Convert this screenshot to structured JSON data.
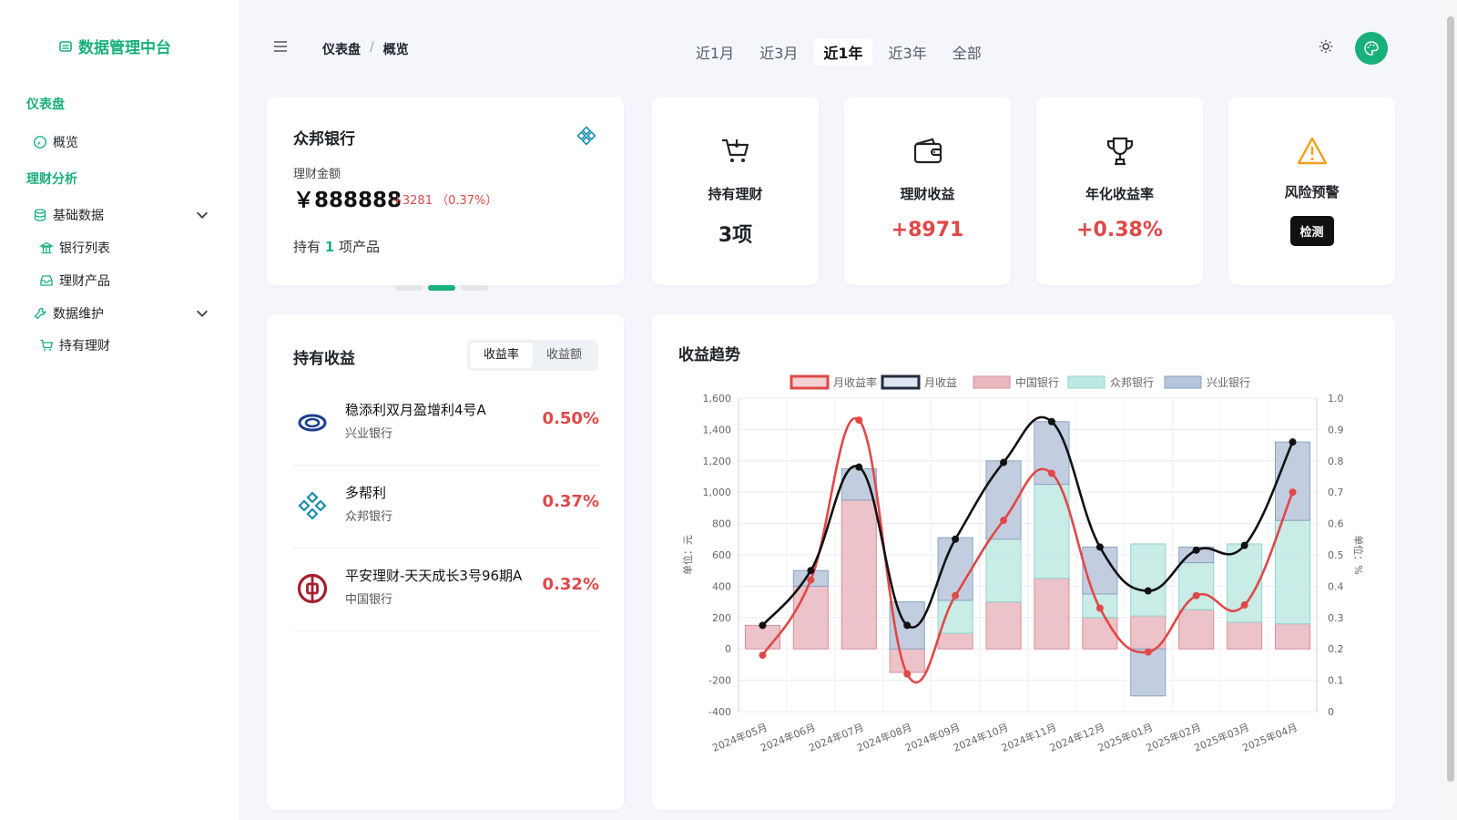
{
  "sidebar": {
    "app_title": "数据管理中台",
    "sections": [
      {
        "title": "仪表盘"
      },
      {
        "title": "理财分析"
      }
    ],
    "items": {
      "overview": "概览",
      "basic_data": "基础数据",
      "bank_list": "银行列表",
      "products": "理财产品",
      "maintenance": "数据维护",
      "holdings": "持有理财"
    }
  },
  "topbar": {
    "breadcrumb": [
      "仪表盘",
      "概览"
    ],
    "separator": "/",
    "ranges": [
      "近1月",
      "近3月",
      "近1年",
      "近3年",
      "全部"
    ],
    "active_range": "近1年"
  },
  "bank_card": {
    "name": "众邦银行",
    "amount_label": "理财金额",
    "amount": "￥888888",
    "change": "+3281 （0.37%）",
    "hold_prefix": "持有",
    "hold_count": "1",
    "hold_suffix": "项产品",
    "carousel_active_index": 1,
    "carousel_count": 3
  },
  "stats": [
    {
      "icon": "cart-icon",
      "label": "持有理财",
      "value": "3项"
    },
    {
      "icon": "wallet-icon",
      "label": "理财收益",
      "value": "+8971"
    },
    {
      "icon": "trophy-icon",
      "label": "年化收益率",
      "value": "+0.38%"
    },
    {
      "icon": "warning-icon",
      "label": "风险预警",
      "button": "检测"
    }
  ],
  "holdings": {
    "title": "持有收益",
    "tabs": [
      "收益率",
      "收益额"
    ],
    "active_tab": "收益率",
    "items": [
      {
        "name": "稳添利双月盈增利4号A",
        "bank": "兴业银行",
        "rate": "0.50%",
        "logo": "cib-logo-icon"
      },
      {
        "name": "多帮利",
        "bank": "众邦银行",
        "rate": "0.37%",
        "logo": "zb-logo-icon"
      },
      {
        "name": "平安理财-天天成长3号96期A",
        "bank": "中国银行",
        "rate": "0.32%",
        "logo": "boc-logo-icon"
      }
    ]
  },
  "chart_data": {
    "type": "bar",
    "title": "收益趋势",
    "categories": [
      "2024年05月",
      "2024年06月",
      "2024年07月",
      "2024年08月",
      "2024年09月",
      "2024年10月",
      "2024年11月",
      "2024年12月",
      "2025年01月",
      "2025年02月",
      "2025年03月",
      "2025年04月"
    ],
    "ylabel": "单位：元",
    "y2label": "单位：%",
    "ylim": [
      -400,
      1600
    ],
    "y_ticks": [
      "-400",
      "-200",
      "0",
      "200",
      "400",
      "600",
      "800",
      "1,000",
      "1,200",
      "1,400",
      "1,600"
    ],
    "y2lim": [
      0,
      1.0
    ],
    "y2_ticks": [
      "0",
      "0.1",
      "0.2",
      "0.3",
      "0.4",
      "0.5",
      "0.6",
      "0.7",
      "0.8",
      "0.9",
      "1.0"
    ],
    "legend_position": "top",
    "grid": true,
    "stacked_bars": true,
    "colors": {
      "rate": "#e04848",
      "income": "#111111",
      "boc": "#e8b9bf",
      "zb": "#bfe9e3",
      "cib": "#b7c6db"
    },
    "series": [
      {
        "name": "中国银行",
        "kind": "bar",
        "values": [
          150,
          400,
          950,
          -150,
          100,
          300,
          450,
          200,
          210,
          250,
          170,
          160
        ]
      },
      {
        "name": "众邦银行",
        "kind": "bar",
        "values": [
          0,
          0,
          0,
          0,
          210,
          400,
          600,
          150,
          460,
          300,
          500,
          660
        ]
      },
      {
        "name": "兴业银行",
        "kind": "bar",
        "values": [
          0,
          100,
          200,
          300,
          400,
          500,
          400,
          300,
          -300,
          100,
          0,
          500
        ]
      },
      {
        "name": "月收益",
        "kind": "line",
        "axis": "left",
        "values": [
          150,
          500,
          1160,
          150,
          700,
          1190,
          1450,
          650,
          370,
          630,
          660,
          1320
        ]
      },
      {
        "name": "月收益率",
        "kind": "line",
        "axis": "right",
        "values": [
          0.18,
          0.42,
          0.93,
          0.12,
          0.37,
          0.61,
          0.76,
          0.33,
          0.19,
          0.37,
          0.34,
          0.7
        ]
      }
    ]
  }
}
